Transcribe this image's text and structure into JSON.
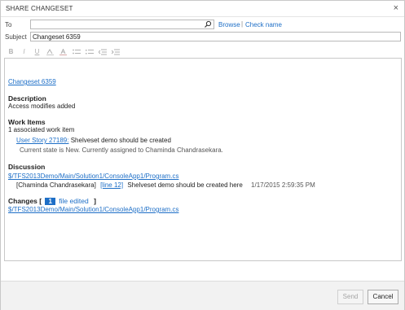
{
  "dialog": {
    "title": "SHARE CHANGESET",
    "close_glyph": "×"
  },
  "form": {
    "to_label": "To",
    "to_value": "",
    "browse_label": "Browse",
    "separator": "|",
    "check_name_label": "Check name",
    "subject_label": "Subject",
    "subject_value": "Changeset 6359"
  },
  "toolbar": {
    "bold": "B",
    "italic": "I",
    "underline": "U",
    "icons": [
      "bold-icon",
      "italic-icon",
      "underline-icon",
      "highlight-icon",
      "font-color-icon",
      "bulleted-list-icon",
      "numbered-list-icon",
      "decrease-indent-icon",
      "increase-indent-icon"
    ]
  },
  "body": {
    "changeset_link": "Changeset 6359",
    "description_heading": "Description",
    "description_text": "Access modifies added",
    "work_items_heading": "Work Items",
    "work_items_count": "1 associated work item",
    "work_item_link": "User Story 27189:",
    "work_item_title": "Shelveset demo should be created",
    "work_item_state": "Current state is New. Currently assigned to Chaminda Chandrasekara.",
    "discussion_heading": "Discussion",
    "discussion_file_link": "$/TFS2013Demo/Main/Solution1/ConsoleApp1/Program.cs",
    "discussion_author": "[Chaminda Chandrasekara]",
    "discussion_line_link": "[line 12]",
    "discussion_comment": "Shelveset demo should be created here",
    "discussion_timestamp": "1/17/2015 2:59:35 PM",
    "changes_heading": "Changes [",
    "changes_count": "1",
    "changes_files_label": "file edited",
    "changes_close": "]",
    "changes_file_link": "$/TFS2013Demo/Main/Solution1/ConsoleApp1/Program.cs"
  },
  "footer": {
    "send_label": "Send",
    "cancel_label": "Cancel"
  },
  "colors": {
    "link": "#1e6fc7",
    "badge": "#1e6fc7"
  }
}
